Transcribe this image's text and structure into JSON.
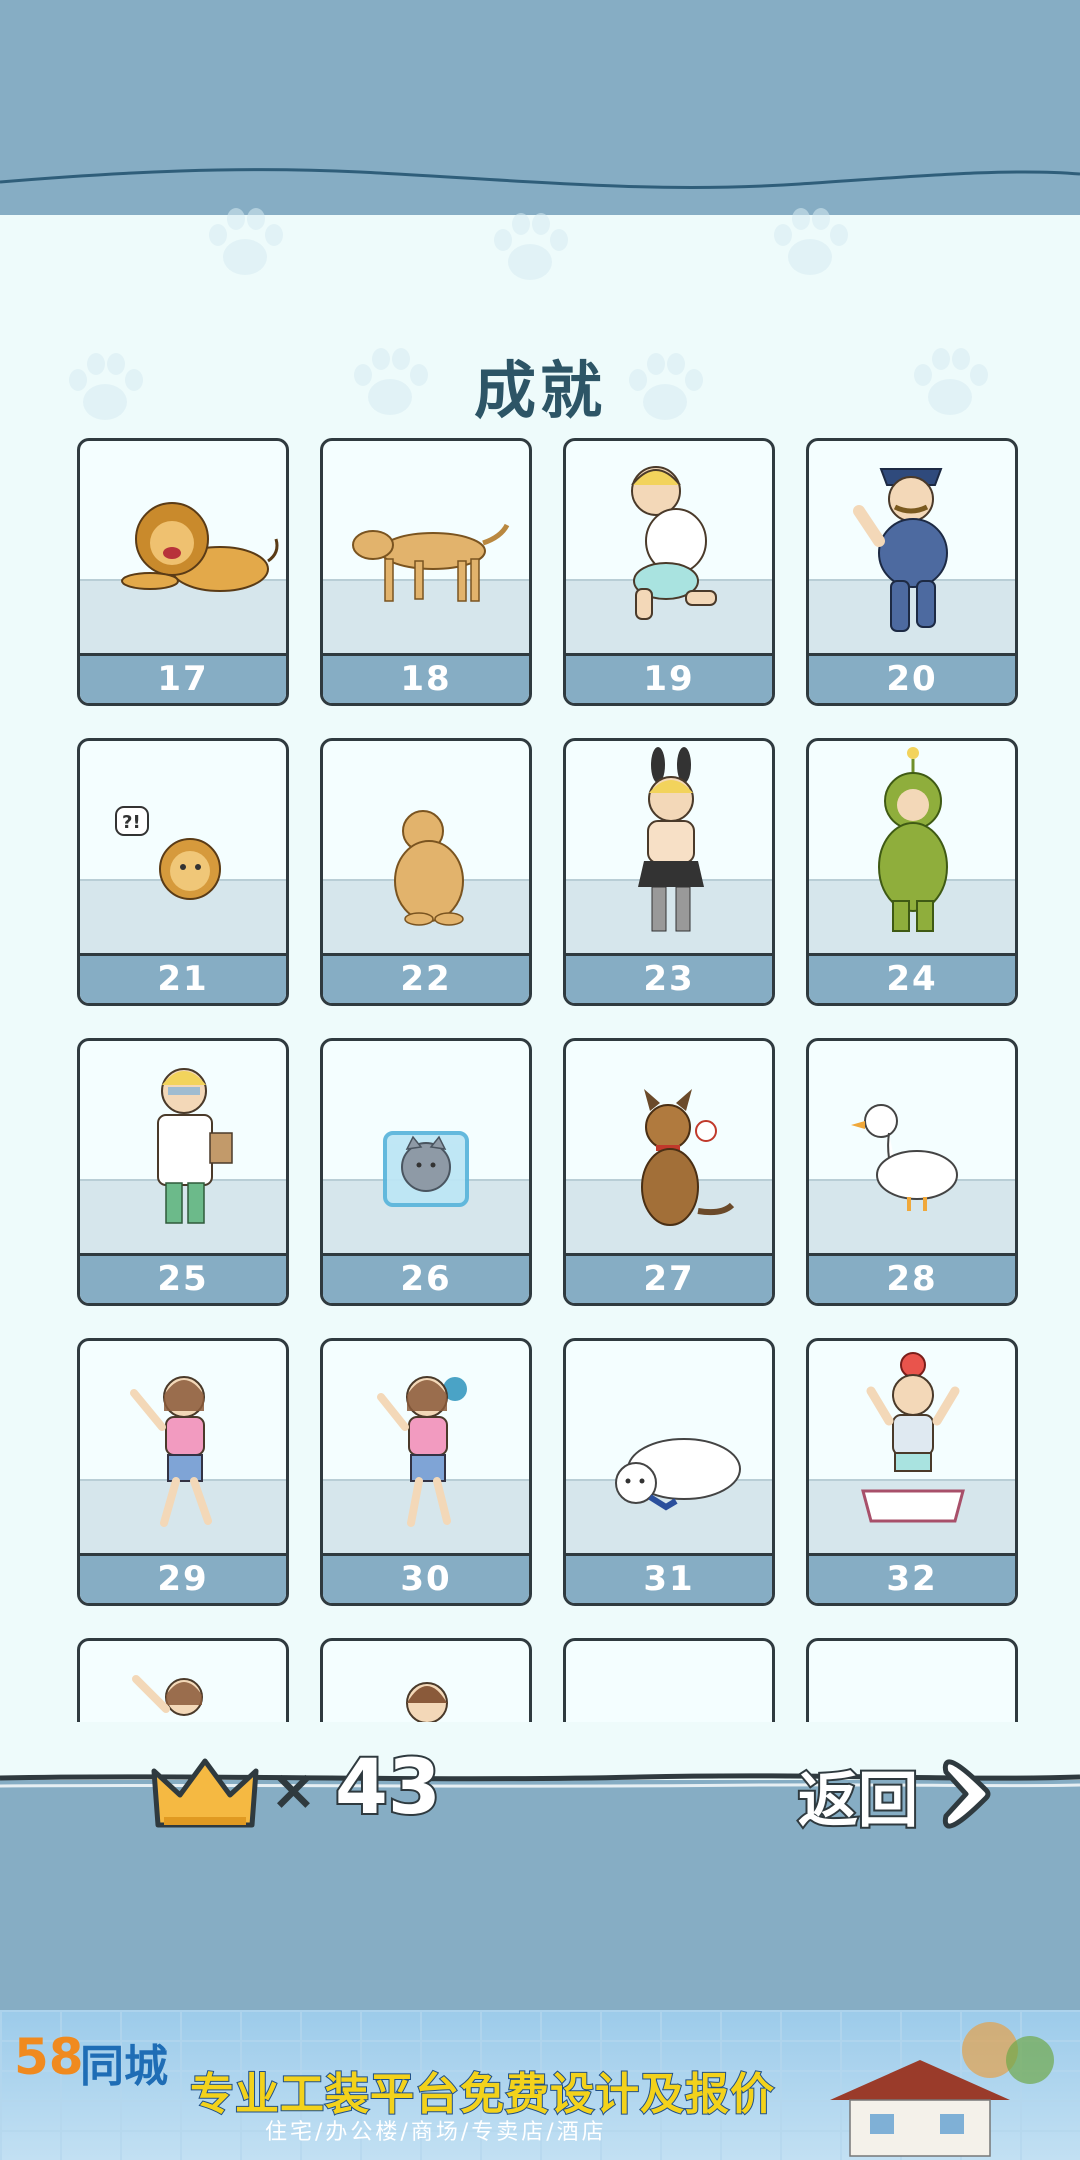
{
  "title": "成就",
  "cards": [
    {
      "number": "17",
      "subject": "lion"
    },
    {
      "number": "18",
      "subject": "dog"
    },
    {
      "number": "19",
      "subject": "man"
    },
    {
      "number": "20",
      "subject": "police-officer"
    },
    {
      "number": "21",
      "subject": "lion-cub"
    },
    {
      "number": "22",
      "subject": "golden-retriever"
    },
    {
      "number": "23",
      "subject": "bunny-costume-man"
    },
    {
      "number": "24",
      "subject": "green-costume-man"
    },
    {
      "number": "25",
      "subject": "doctor"
    },
    {
      "number": "26",
      "subject": "frozen-cat"
    },
    {
      "number": "27",
      "subject": "shepherd-dog"
    },
    {
      "number": "28",
      "subject": "duck"
    },
    {
      "number": "29",
      "subject": "woman"
    },
    {
      "number": "30",
      "subject": "woman-with-cat"
    },
    {
      "number": "31",
      "subject": "polar-bear"
    },
    {
      "number": "32",
      "subject": "man-in-litter-box"
    },
    {
      "number": "",
      "subject": "woman"
    },
    {
      "number": "",
      "subject": "girl"
    },
    {
      "number": "",
      "subject": ""
    },
    {
      "number": "",
      "subject": ""
    }
  ],
  "score": {
    "icon": "crown-icon",
    "times": "×",
    "count": "43"
  },
  "back_button": {
    "label": "返回",
    "icon": "chevron-right-icon"
  },
  "ad": {
    "brand_num": "58",
    "brand_text": "同城",
    "headline": "专业工装平台免费设计及报价",
    "subline": "住宅/办公楼/商场/专卖店/酒店"
  },
  "colors": {
    "band": "#86adc4",
    "background": "#eefbfb",
    "ink": "#2f3a3f",
    "title": "#2d5566"
  }
}
